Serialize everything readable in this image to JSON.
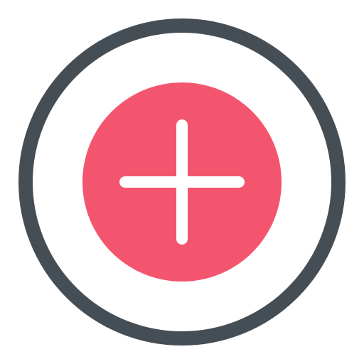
{
  "icon": {
    "name": "add-circle-icon",
    "ring_color": "#454d55",
    "fill_color": "#f4556e",
    "plus_color": "#ffffff",
    "background_color": "#ffffff"
  }
}
